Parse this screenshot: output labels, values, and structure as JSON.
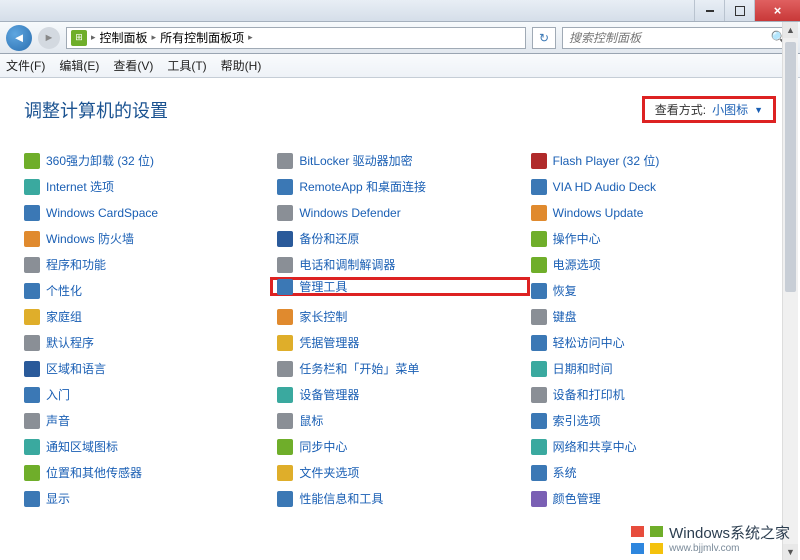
{
  "titlebar": {
    "close_label": "×"
  },
  "nav": {
    "breadcrumb": {
      "root": "控制面板",
      "current": "所有控制面板项"
    },
    "search_placeholder": "搜索控制面板"
  },
  "menu": {
    "file": "文件(F)",
    "edit": "编辑(E)",
    "view": "查看(V)",
    "tools": "工具(T)",
    "help": "帮助(H)"
  },
  "header": {
    "title": "调整计算机的设置",
    "view_label": "查看方式:",
    "view_value": "小图标"
  },
  "items": {
    "col0": [
      {
        "label": "360强力卸载 (32 位)",
        "icon": "c-green"
      },
      {
        "label": "Internet 选项",
        "icon": "c-teal"
      },
      {
        "label": "Windows CardSpace",
        "icon": "c-blue"
      },
      {
        "label": "Windows 防火墙",
        "icon": "c-orange"
      },
      {
        "label": "程序和功能",
        "icon": "c-gray"
      },
      {
        "label": "个性化",
        "icon": "c-blue"
      },
      {
        "label": "家庭组",
        "icon": "c-yellow"
      },
      {
        "label": "默认程序",
        "icon": "c-gray"
      },
      {
        "label": "区域和语言",
        "icon": "c-dblue"
      },
      {
        "label": "入门",
        "icon": "c-blue"
      },
      {
        "label": "声音",
        "icon": "c-gray"
      },
      {
        "label": "通知区域图标",
        "icon": "c-teal"
      },
      {
        "label": "位置和其他传感器",
        "icon": "c-green"
      },
      {
        "label": "显示",
        "icon": "c-blue"
      }
    ],
    "col1": [
      {
        "label": "BitLocker 驱动器加密",
        "icon": "c-gray"
      },
      {
        "label": "RemoteApp 和桌面连接",
        "icon": "c-blue"
      },
      {
        "label": "Windows Defender",
        "icon": "c-gray"
      },
      {
        "label": "备份和还原",
        "icon": "c-dblue"
      },
      {
        "label": "电话和调制解调器",
        "icon": "c-gray"
      },
      {
        "label": "管理工具",
        "icon": "c-blue",
        "highlight": true
      },
      {
        "label": "家长控制",
        "icon": "c-orange"
      },
      {
        "label": "凭据管理器",
        "icon": "c-yellow"
      },
      {
        "label": "任务栏和「开始」菜单",
        "icon": "c-gray"
      },
      {
        "label": "设备管理器",
        "icon": "c-teal"
      },
      {
        "label": "鼠标",
        "icon": "c-gray"
      },
      {
        "label": "同步中心",
        "icon": "c-green"
      },
      {
        "label": "文件夹选项",
        "icon": "c-yellow"
      },
      {
        "label": "性能信息和工具",
        "icon": "c-blue"
      }
    ],
    "col2": [
      {
        "label": "Flash Player (32 位)",
        "icon": "c-flash"
      },
      {
        "label": "VIA HD Audio Deck",
        "icon": "c-blue"
      },
      {
        "label": "Windows Update",
        "icon": "c-orange"
      },
      {
        "label": "操作中心",
        "icon": "c-green"
      },
      {
        "label": "电源选项",
        "icon": "c-green"
      },
      {
        "label": "恢复",
        "icon": "c-blue"
      },
      {
        "label": "键盘",
        "icon": "c-gray"
      },
      {
        "label": "轻松访问中心",
        "icon": "c-blue"
      },
      {
        "label": "日期和时间",
        "icon": "c-teal"
      },
      {
        "label": "设备和打印机",
        "icon": "c-gray"
      },
      {
        "label": "索引选项",
        "icon": "c-blue"
      },
      {
        "label": "网络和共享中心",
        "icon": "c-teal"
      },
      {
        "label": "系统",
        "icon": "c-blue"
      },
      {
        "label": "颜色管理",
        "icon": "c-purple"
      }
    ]
  },
  "watermark": {
    "line1": "Windows系统之家",
    "line2": "www.bjjmlv.com"
  }
}
